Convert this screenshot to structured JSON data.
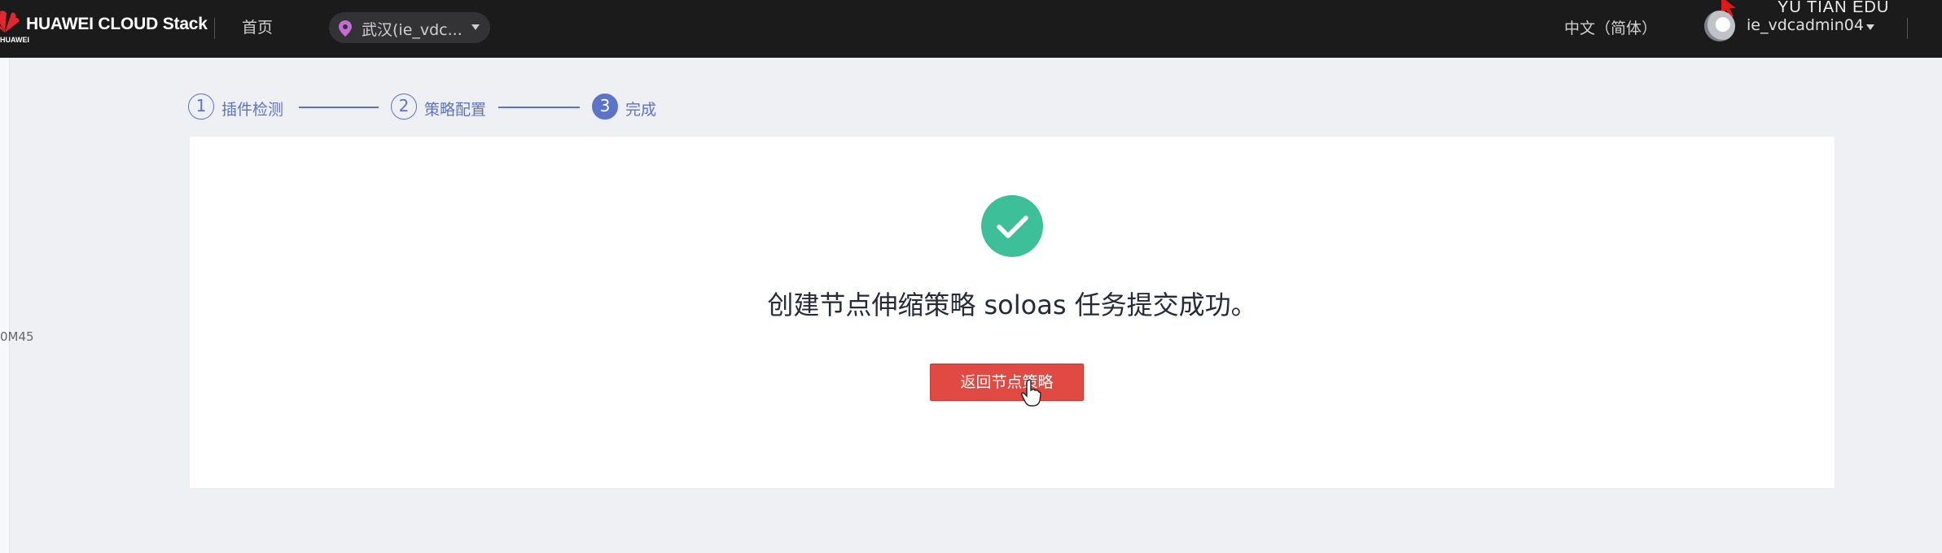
{
  "header": {
    "brand_sub": "HUAWEI",
    "brand_title": "HUAWEI CLOUD Stack",
    "home_label": "首页",
    "region_label": "武汉(ie_vdc...",
    "language_label": "中文（简体）",
    "username": "ie_vdcadmin04",
    "watermark": "YU TIAN EDU"
  },
  "left_edge": {
    "clipped_text": "0M45"
  },
  "steps": [
    {
      "number": "1",
      "label": "插件检测",
      "state": "done"
    },
    {
      "number": "2",
      "label": "策略配置",
      "state": "done"
    },
    {
      "number": "3",
      "label": "完成",
      "state": "active"
    }
  ],
  "result": {
    "message": "创建节点伸缩策略 soloas 任务提交成功。",
    "back_button_label": "返回节点策略"
  },
  "colors": {
    "topbar": "#1b1b1c",
    "accent": "#5b73c8",
    "success": "#3dbf9a",
    "primary_button": "#e04a43",
    "page_bg": "#eef0f4"
  }
}
